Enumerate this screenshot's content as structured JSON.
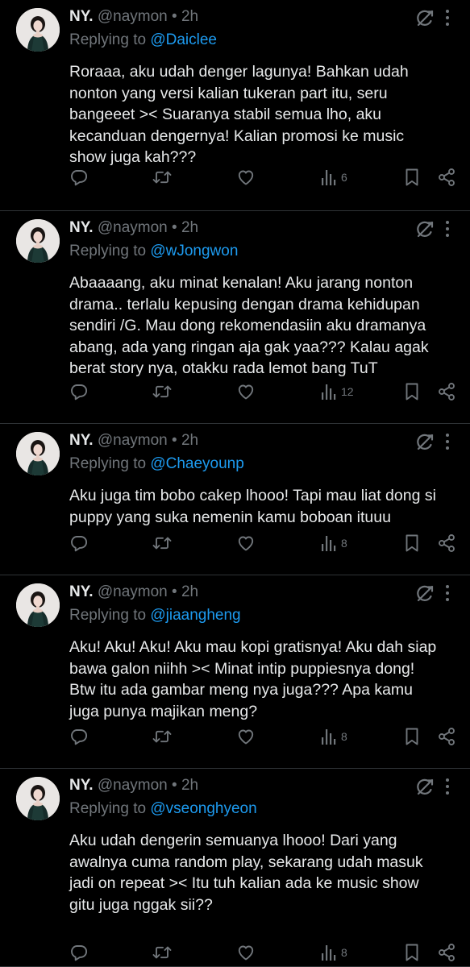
{
  "icons": {
    "reply": "reply-bubble-icon",
    "retweet": "retweet-icon",
    "like": "heart-icon",
    "views": "views-bars-icon",
    "bookmark": "bookmark-icon",
    "share": "share-icon",
    "grok": "grok-icon",
    "more": "more-vertical-icon"
  },
  "colors": {
    "background": "#000000",
    "text": "#e7e9ea",
    "muted": "#71767b",
    "mention": "#1d9bf0",
    "divider": "#2f3336"
  },
  "tweets": [
    {
      "name": "NY.",
      "handle": "@naymon",
      "time": "2h",
      "replying_prefix": "Replying to",
      "mention": "@Daiclee",
      "lines": [
        "Roraaa, aku udah denger lagunya! Bahkan udah",
        "nonton yang versi kalian tukeran part itu, seru",
        "bangeeet >< Suaranya stabil semua lho, aku",
        "kecanduan dengernya! Kalian promosi ke music",
        "show juga kah???"
      ],
      "views": "6"
    },
    {
      "name": "NY.",
      "handle": "@naymon",
      "time": "2h",
      "replying_prefix": "Replying to",
      "mention": "@wJongwon",
      "lines": [
        "Abaaaang, aku minat kenalan! Aku jarang nonton",
        "drama.. terlalu kepusing dengan drama kehidupan",
        "sendiri /G. Mau dong rekomendasiin aku dramanya",
        "abang, ada yang ringan aja gak yaa??? Kalau agak",
        "berat story nya, otakku rada lemot bang TuT"
      ],
      "views": "12"
    },
    {
      "name": "NY.",
      "handle": "@naymon",
      "time": "2h",
      "replying_prefix": "Replying to",
      "mention": "@Chaeyounp",
      "lines": [
        "Aku juga tim bobo cakep lhooo! Tapi mau liat dong si",
        "puppy yang suka nemenin kamu boboan ituuu"
      ],
      "views": "8"
    },
    {
      "name": "NY.",
      "handle": "@naymon",
      "time": "2h",
      "replying_prefix": "Replying to",
      "mention": "@jiaangheng",
      "lines": [
        "Aku! Aku! Aku! Aku mau kopi gratisnya! Aku dah siap",
        "bawa galon niihh >< Minat intip puppiesnya dong!",
        "Btw itu ada gambar meng nya juga??? Apa kamu",
        "juga punya majikan meng?"
      ],
      "views": "8"
    },
    {
      "name": "NY.",
      "handle": "@naymon",
      "time": "2h",
      "replying_prefix": "Replying to",
      "mention": "@vseonghyeon",
      "lines": [
        "Aku udah dengerin semuanya lhooo! Dari yang",
        "awalnya cuma random play, sekarang udah masuk",
        "jadi on repeat >< Itu tuh kalian ada ke music show",
        "gitu juga nggak sii??"
      ],
      "views": "8"
    }
  ]
}
